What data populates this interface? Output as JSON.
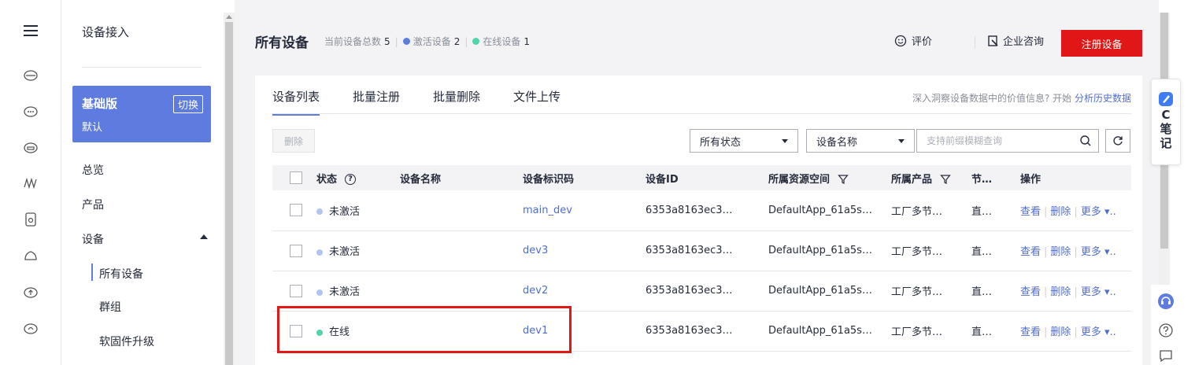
{
  "menu": {
    "title": "设备接入",
    "plan_name": "基础版",
    "plan_switch": "切换",
    "plan_sub": "默认",
    "items": [
      "总览",
      "产品",
      "设备"
    ],
    "sub_items": [
      "所有设备",
      "群组",
      "软固件升级"
    ]
  },
  "header": {
    "title": "所有设备",
    "total_label": "当前设备总数",
    "total_value": "5",
    "activated_label": "激活设备",
    "activated_value": "2",
    "online_label": "在线设备",
    "online_value": "1",
    "evaluate": "评价",
    "consult": "企业咨询",
    "register": "注册设备"
  },
  "tabs": [
    "设备列表",
    "批量注册",
    "批量删除",
    "文件上传"
  ],
  "insight": {
    "text": "深入洞察设备数据中的价值信息? 开始",
    "link": "分析历史数据"
  },
  "toolbar": {
    "delete": "删除",
    "status_select": "所有状态",
    "field_select": "设备名称",
    "search_placeholder": "支持前缀模糊查询"
  },
  "table": {
    "columns": [
      "状态",
      "设备名称",
      "设备标识码",
      "设备ID",
      "所属资源空间",
      "所属产品",
      "节…",
      "操作"
    ],
    "rows": [
      {
        "status": "未激活",
        "name": "",
        "code": "main_dev",
        "id": "6353a8163ec3…",
        "space": "DefaultApp_61a5s…",
        "product": "工厂多节…",
        "node": "直…"
      },
      {
        "status": "未激活",
        "name": "",
        "code": "dev3",
        "id": "6353a8163ec3…",
        "space": "DefaultApp_61a5s…",
        "product": "工厂多节…",
        "node": "直…"
      },
      {
        "status": "未激活",
        "name": "",
        "code": "dev2",
        "id": "6353a8163ec3…",
        "space": "DefaultApp_61a5s…",
        "product": "工厂多节…",
        "node": "直…"
      },
      {
        "status": "在线",
        "name": "",
        "code": "dev1",
        "id": "6353a8163ec3…",
        "space": "DefaultApp_61a5s…",
        "product": "工厂多节…",
        "node": "直…"
      }
    ],
    "ops": {
      "view": "查看",
      "delete": "删除",
      "more": "更多 ▾.."
    }
  },
  "floater": {
    "note": "C笔记"
  },
  "colors": {
    "accent": "#5e7ce0",
    "danger": "#e11717",
    "inactive_dot": "#b4c4f0",
    "online_dot": "#50d4ab",
    "activated_dot": "#5e7ce0"
  }
}
